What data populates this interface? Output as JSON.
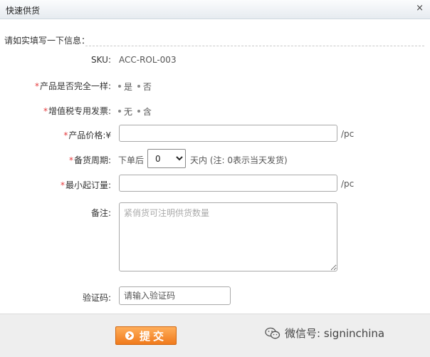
{
  "dialog": {
    "title": "快速供货",
    "close_glyph": "×"
  },
  "intro": "请如实填写一下信息：",
  "sku": {
    "label": "SKU:",
    "value": "ACC-ROL-003"
  },
  "same_product": {
    "required": "*",
    "label": "产品是否完全一样:",
    "options": [
      "是",
      "否"
    ]
  },
  "vat_invoice": {
    "required": "*",
    "label": "增值税专用发票:",
    "options": [
      "无",
      "含"
    ]
  },
  "price": {
    "required": "*",
    "label": "产品价格:¥",
    "value": "",
    "unit": "/pc"
  },
  "stock_period": {
    "required": "*",
    "label": "备货周期:",
    "before": "下单后",
    "selected": "0",
    "after": "天内 (注: 0表示当天发货)"
  },
  "moq": {
    "required": "*",
    "label": "最小起订量:",
    "value": "",
    "unit": "/pc"
  },
  "remark": {
    "label": "备注:",
    "placeholder": "紧俏货可注明供货数量"
  },
  "captcha": {
    "label": "验证码:",
    "placeholder": "请输入验证码"
  },
  "footer": {
    "submit_label": "提交",
    "watermark": "微信号: signinchina"
  },
  "colors": {
    "required": "#e4393c",
    "submit": "#f07a1c",
    "footer_bg": "#eeeeee"
  }
}
